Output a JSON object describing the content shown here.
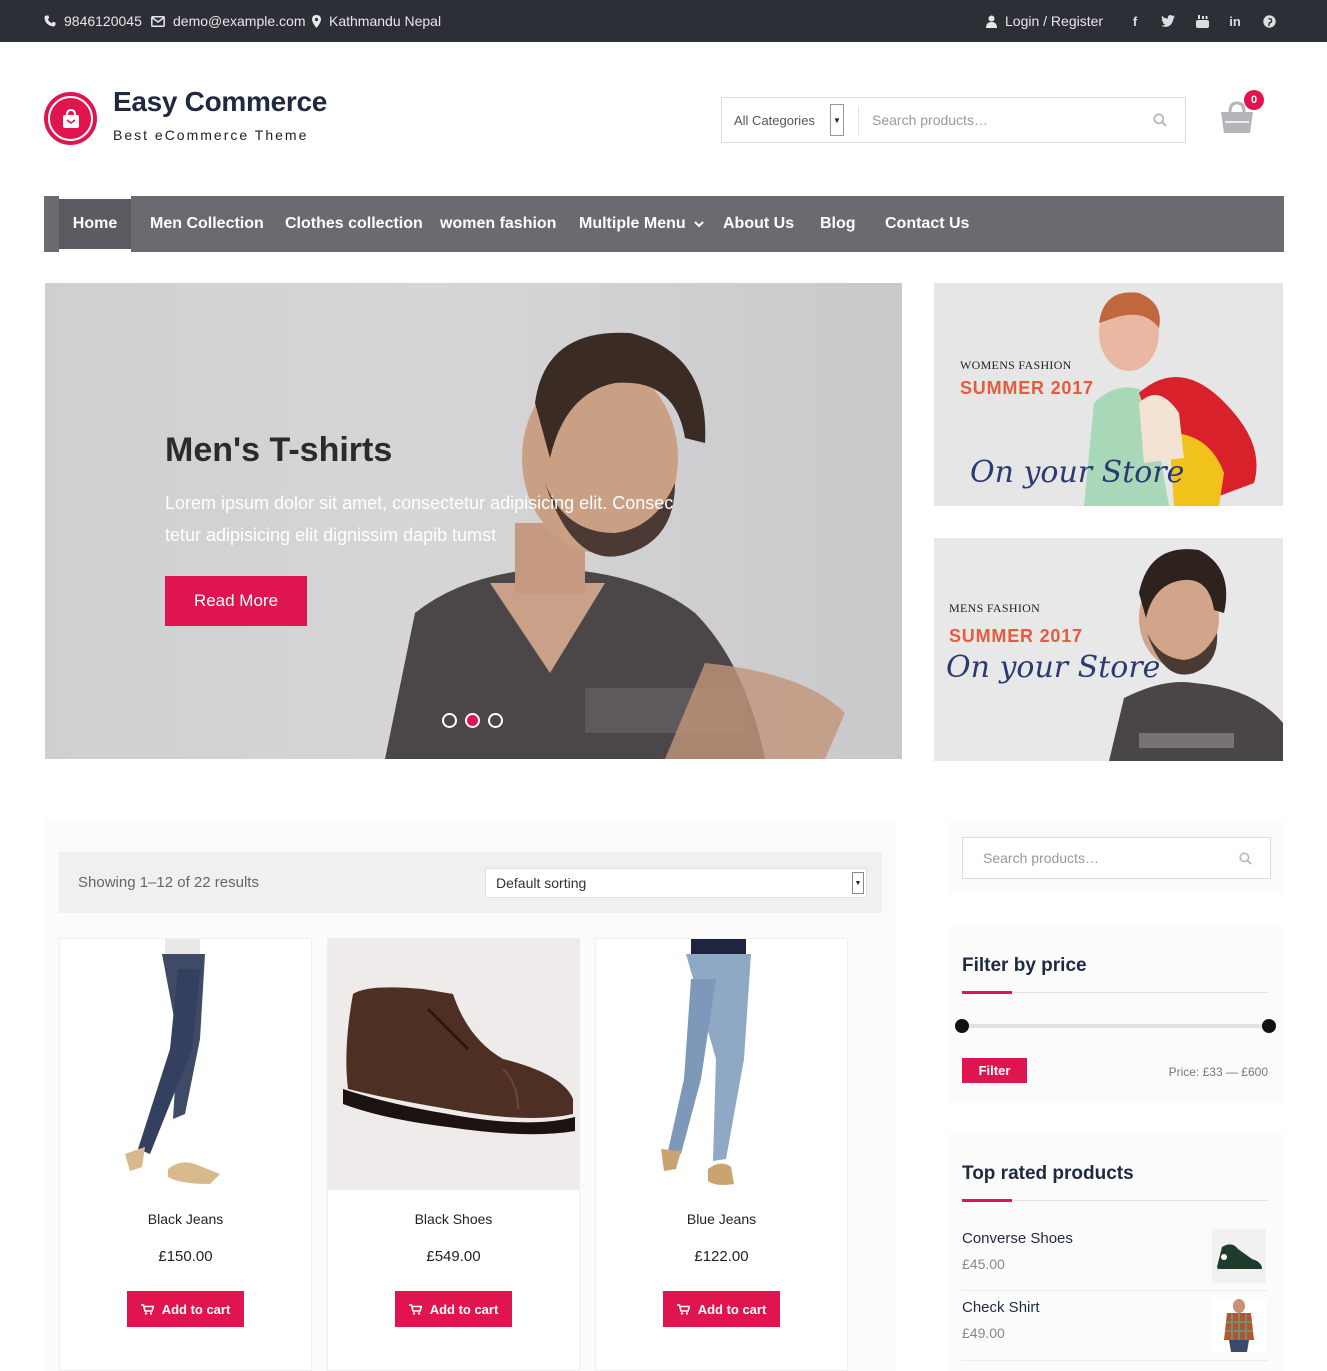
{
  "topbar": {
    "phone": "9846120045",
    "email": "demo@example.com",
    "location": "Kathmandu Nepal",
    "login": "Login / Register",
    "social": [
      "facebook-icon",
      "twitter-icon",
      "youtube-icon",
      "linkedin-icon",
      "pinterest-icon"
    ]
  },
  "header": {
    "title": "Easy Commerce",
    "tagline": "Best eCommerce Theme",
    "search": {
      "category": "All Categories",
      "placeholder": "Search products…"
    },
    "cart_count": "0"
  },
  "nav": {
    "items": [
      "Home",
      "Men Collection",
      "Clothes collection",
      "women fashion",
      "Multiple Menu",
      "About Us",
      "Blog",
      "Contact Us"
    ],
    "active": "Home"
  },
  "hero": {
    "title": "Men's T-shirts",
    "text": "Lorem ipsum dolor sit amet, consectetur adipisicing elit. Consec tetur adipisicing elit dignissim dapib tumst",
    "button": "Read More",
    "active_slide": 2,
    "slide_count": 3
  },
  "promos": [
    {
      "kicker": "WOMENS FASHION",
      "headline": "SUMMER 2017",
      "script": "On your Store"
    },
    {
      "kicker": "MENS FASHION",
      "headline": "SUMMER 2017",
      "script": "On your Store"
    }
  ],
  "shop": {
    "count": "Showing 1–12 of 22 results",
    "sorting": "Default sorting",
    "products": [
      {
        "name": "Black Jeans",
        "price": "£150.00",
        "button": "Add to cart"
      },
      {
        "name": "Black Shoes",
        "price": "£549.00",
        "button": "Add to cart"
      },
      {
        "name": "Blue Jeans",
        "price": "£122.00",
        "button": "Add to cart"
      }
    ]
  },
  "sidebar": {
    "search_placeholder": "Search products…",
    "filter": {
      "title": "Filter by price",
      "button": "Filter",
      "range": "Price: £33 — £600"
    },
    "top_rated": {
      "title": "Top rated products",
      "items": [
        {
          "name": "Converse Shoes",
          "price": "£45.00"
        },
        {
          "name": "Check Shirt",
          "price": "£49.00"
        }
      ]
    }
  },
  "colors": {
    "accent": "#e0154f",
    "topbar": "#2d2f36",
    "nav": "#6b6a71",
    "title": "#1f2940"
  }
}
